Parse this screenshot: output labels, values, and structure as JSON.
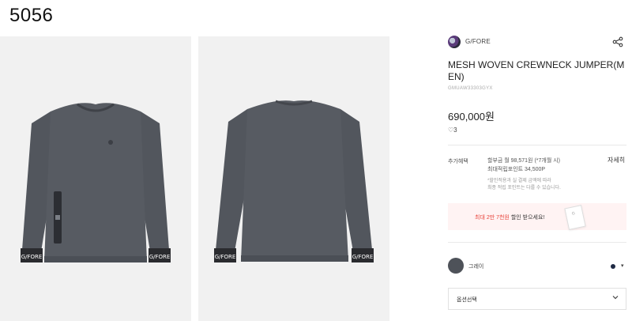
{
  "page_number": "5056",
  "product": {
    "brand": "G/FORE",
    "brand_logo_icon": "brand-logo-icon",
    "title": "MESH WOVEN CREWNECK JUMPER(MEN)",
    "code": "GMUAW33303GYX",
    "price": "690,000원",
    "likes": "3",
    "images": [
      {
        "view": "front",
        "cuff_text": "G/FORE"
      },
      {
        "view": "back",
        "cuff_text": "G/FORE"
      }
    ]
  },
  "benefit": {
    "label": "추가혜택",
    "installment": "할부금 월 98,571원 (*7개월 시)",
    "points": "최대적립포인트 34,500P",
    "note_line1": "*할인적용과 실 결제 금액에 따라",
    "note_line2": "최종 적립 포인트는 다를 수 있습니다.",
    "detail_label": "자세히"
  },
  "promo": {
    "prefix": "최대 2만 7천원",
    "suffix": " 할인 받으세요!",
    "card_logo": "G",
    "accent_color": "#e8433a"
  },
  "color_option": {
    "name": "그레이",
    "swatch_color": "#4e5259",
    "alt_color": "#1f2a44",
    "caret": "▾"
  },
  "option_select": {
    "placeholder": "옵션선택"
  },
  "colors": {
    "garment": "#555960",
    "background": "#f1f1f1"
  }
}
